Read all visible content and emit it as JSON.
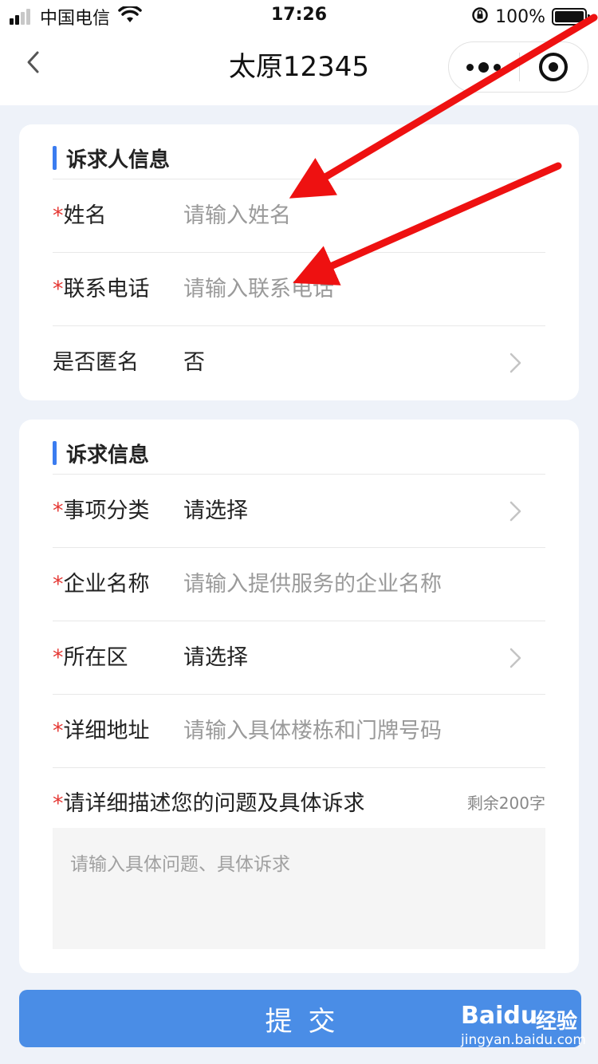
{
  "status_bar": {
    "carrier": "中国电信",
    "time": "17:26",
    "battery": "100%"
  },
  "nav": {
    "title": "太原12345"
  },
  "section_requester": {
    "title": "诉求人信息",
    "name_label": "姓名",
    "name_placeholder": "请输入姓名",
    "phone_label": "联系电话",
    "phone_placeholder": "请输入联系电话",
    "anonymous_label": "是否匿名",
    "anonymous_value": "否"
  },
  "section_request": {
    "title": "诉求信息",
    "category_label": "事项分类",
    "category_value": "请选择",
    "company_label": "企业名称",
    "company_placeholder": "请输入提供服务的企业名称",
    "district_label": "所在区",
    "district_value": "请选择",
    "address_label": "详细地址",
    "address_placeholder": "请输入具体楼栋和门牌号码",
    "description_label": "请详细描述您的问题及具体诉求",
    "description_counter": "剩余200字",
    "description_placeholder": "请输入具体问题、具体诉求"
  },
  "submit_label": "提交",
  "required_mark": "*",
  "watermark": {
    "brand": "Baidu",
    "brand_cn": "经验",
    "url": "jingyan.baidu.com"
  },
  "colors": {
    "accent": "#3b7cf0",
    "submit_bg": "#4a8de6",
    "required": "#e53935",
    "arrow": "#ee1111"
  }
}
